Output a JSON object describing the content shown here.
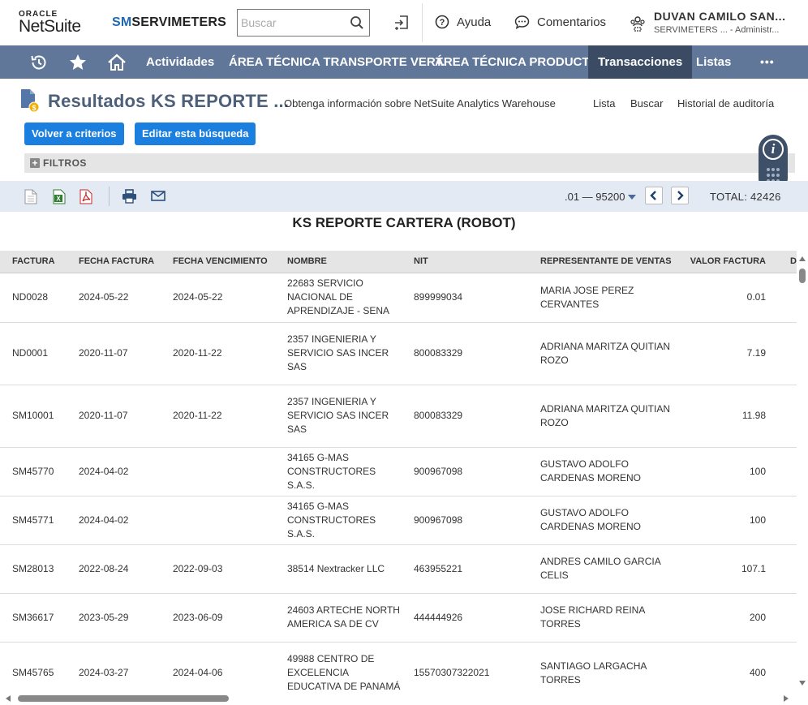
{
  "header": {
    "oracle_text": "ORACLE",
    "netsuite_text": "NetSuite",
    "company_prefix": "SM",
    "company_name": "SERVIMETERS",
    "search_placeholder": "Buscar",
    "help_label": "Ayuda",
    "feedback_label": "Comentarios",
    "user_name": "DUVAN CAMILO SAN...",
    "user_role": "SERVIMETERS ... - Administr..."
  },
  "nav": {
    "items": [
      "Actividades",
      "ÁREA TÉCNICA TRANSPORTE VERT.",
      "ÁREA TÉCNICA PRODUCTO",
      "Transacciones",
      "Listas"
    ],
    "active": "Transacciones",
    "more": "•••"
  },
  "page": {
    "title": "Resultados KS REPORTE ...",
    "links": [
      "Obtenga información sobre NetSuite Analytics Warehouse",
      "Lista",
      "Buscar",
      "Historial de auditoría"
    ],
    "buttons": {
      "back": "Volver a criterios",
      "edit": "Editar esta búsqueda"
    },
    "filters_label": "FILTROS",
    "info_icon": "i"
  },
  "toolbar": {
    "range": ".01 — 95200",
    "total": "TOTAL: 42426"
  },
  "report": {
    "title": "KS REPORTE CARTERA (ROBOT)",
    "columns": [
      "FACTURA",
      "FECHA FACTURA",
      "FECHA VENCIMIENTO",
      "NOMBRE",
      "NIT",
      "REPRESENTANTE DE VENTAS",
      "VALOR FACTURA",
      "DIAS"
    ],
    "rows": [
      {
        "factura": "ND0028",
        "fecha_factura": "2024-05-22",
        "fecha_venc": "2024-05-22",
        "nombre": "22683 SERVICIO NACIONAL DE APRENDIZAJE - SENA",
        "nit": "899999034",
        "rep": "MARIA JOSE PEREZ CERVANTES",
        "valor": "0.01"
      },
      {
        "factura": "ND0001",
        "fecha_factura": "2020-11-07",
        "fecha_venc": "2020-11-22",
        "nombre": "2357 INGENIERIA Y SERVICIO SAS INCER SAS",
        "nit": "800083329",
        "rep": "ADRIANA MARITZA QUITIAN ROZO",
        "valor": "7.19"
      },
      {
        "factura": "SM10001",
        "fecha_factura": "2020-11-07",
        "fecha_venc": "2020-11-22",
        "nombre": "2357 INGENIERIA Y SERVICIO SAS INCER SAS",
        "nit": "800083329",
        "rep": "ADRIANA MARITZA QUITIAN ROZO",
        "valor": "11.98"
      },
      {
        "factura": "SM45770",
        "fecha_factura": "2024-04-02",
        "fecha_venc": "",
        "nombre": "34165 G-MAS CONSTRUCTORES S.A.S.",
        "nit": "900967098",
        "rep": "GUSTAVO ADOLFO CARDENAS MORENO",
        "valor": "100"
      },
      {
        "factura": "SM45771",
        "fecha_factura": "2024-04-02",
        "fecha_venc": "",
        "nombre": "34165 G-MAS CONSTRUCTORES S.A.S.",
        "nit": "900967098",
        "rep": "GUSTAVO ADOLFO CARDENAS MORENO",
        "valor": "100"
      },
      {
        "factura": "SM28013",
        "fecha_factura": "2022-08-24",
        "fecha_venc": "2022-09-03",
        "nombre": "38514 Nextracker LLC",
        "nit": "463955221",
        "rep": "ANDRES CAMILO GARCIA CELIS",
        "valor": "107.1"
      },
      {
        "factura": "SM36617",
        "fecha_factura": "2023-05-29",
        "fecha_venc": "2023-06-09",
        "nombre": "24603 ARTECHE NORTH AMERICA SA DE CV",
        "nit": "444444926",
        "rep": "JOSE RICHARD REINA TORRES",
        "valor": "200"
      },
      {
        "factura": "SM45765",
        "fecha_factura": "2024-03-27",
        "fecha_venc": "2024-04-06",
        "nombre": "49988 CENTRO DE EXCELENCIA EDUCATIVA DE PANAMÁ",
        "nit": "15570307322021",
        "rep": "SANTIAGO LARGACHA TORRES",
        "valor": "400"
      }
    ]
  }
}
